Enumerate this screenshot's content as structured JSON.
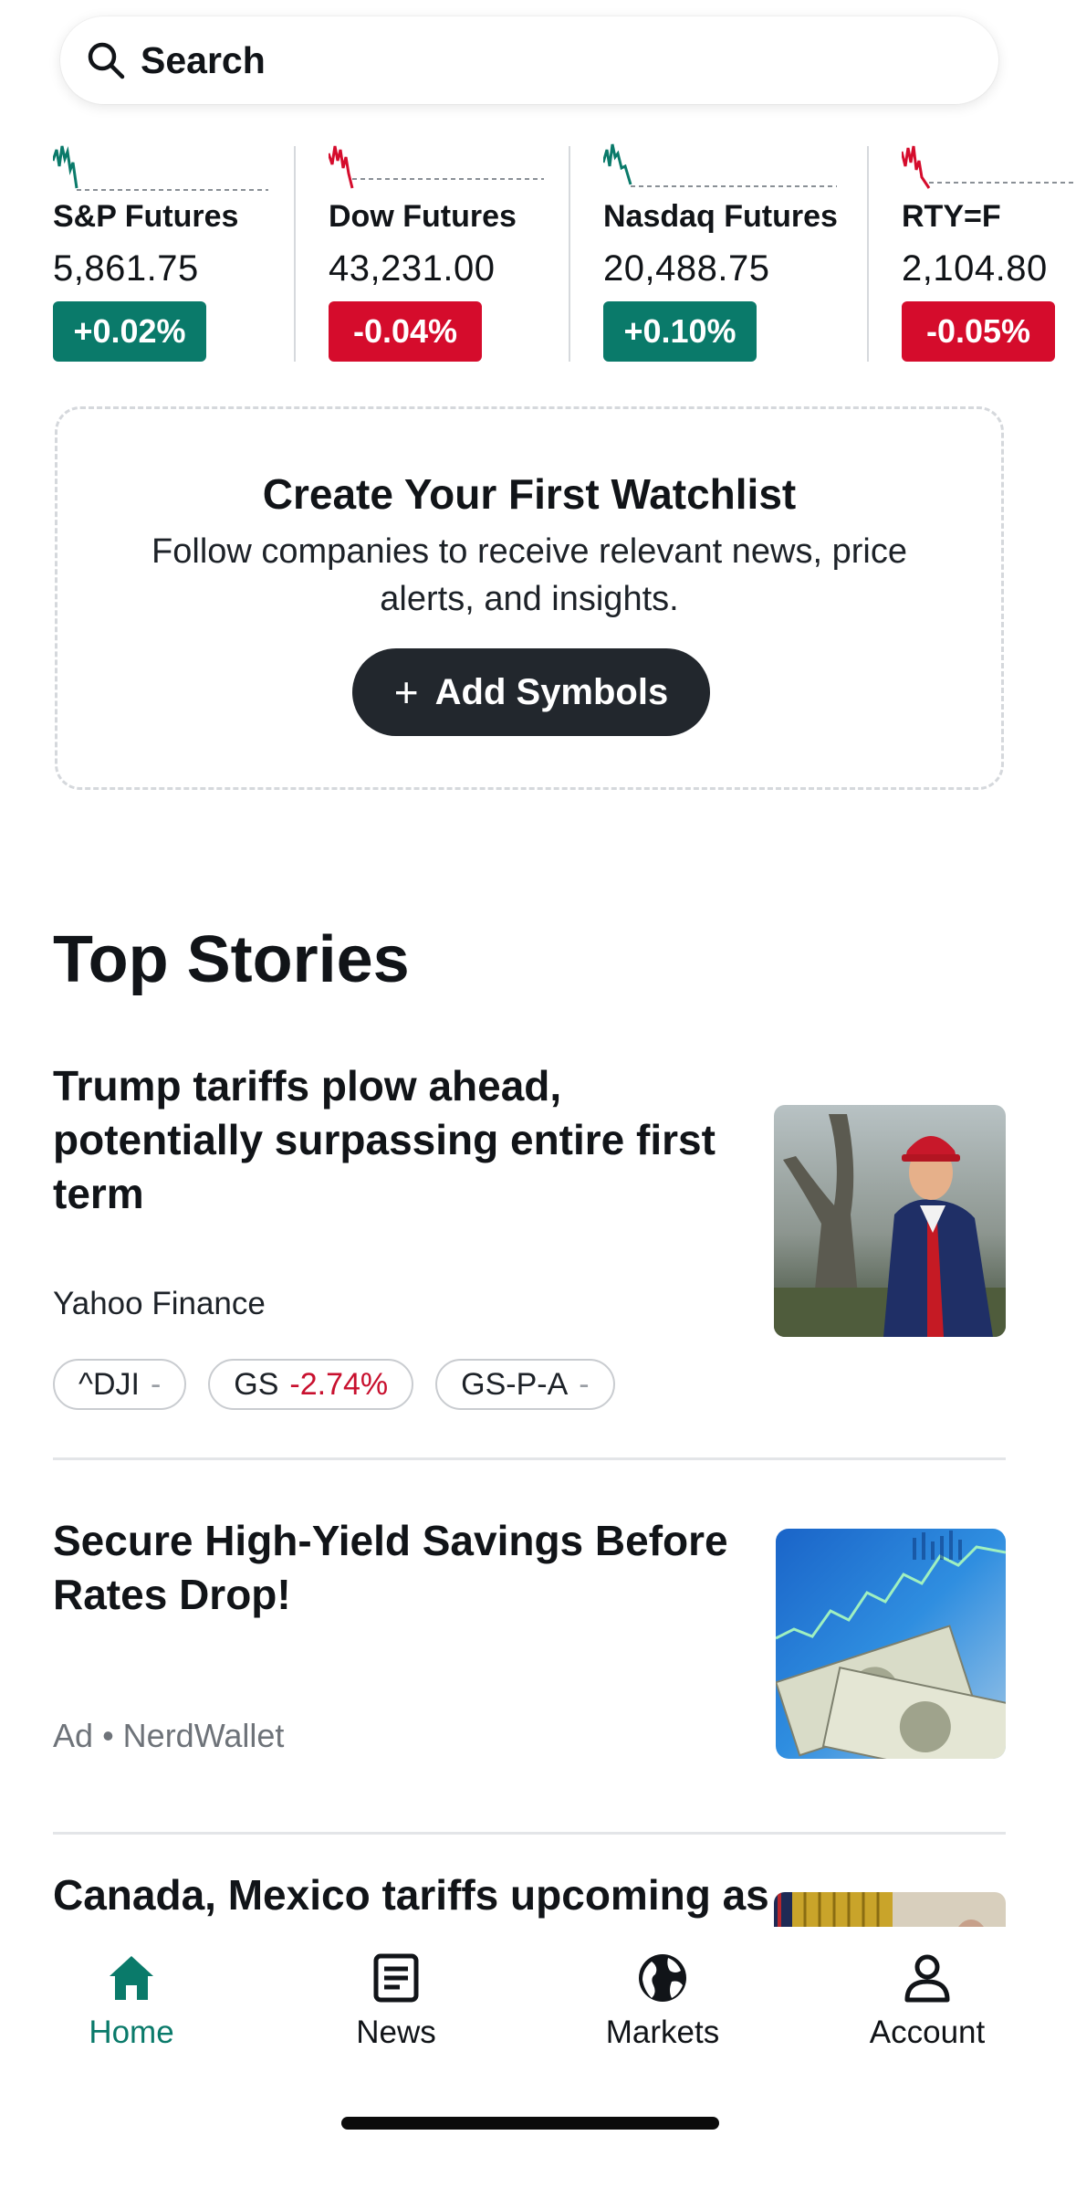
{
  "search": {
    "label": "Search",
    "icon": "search-icon"
  },
  "tickers": [
    {
      "name": "S&P Futures",
      "price": "5,861.75",
      "change": "+0.02%",
      "direction": "up",
      "color": "#0a7a6a"
    },
    {
      "name": "Dow Futures",
      "price": "43,231.00",
      "change": "-0.04%",
      "direction": "down",
      "color": "#d50c2c"
    },
    {
      "name": "Nasdaq Futures",
      "price": "20,488.75",
      "change": "+0.10%",
      "direction": "up",
      "color": "#0a7a6a"
    },
    {
      "name": "RTY=F",
      "price": "2,104.80",
      "change": "-0.05%",
      "direction": "down",
      "color": "#d50c2c"
    }
  ],
  "watchlist": {
    "title": "Create Your First Watchlist",
    "description": "Follow companies to receive relevant news, price alerts, and insights.",
    "button_label": "Add Symbols"
  },
  "top_stories": {
    "title": "Top Stories",
    "stories": [
      {
        "headline": "Trump tariffs plow ahead, potentially surpassing entire first term",
        "source": "Yahoo Finance",
        "chips": [
          {
            "symbol": "^DJI",
            "change": "-"
          },
          {
            "symbol": "GS",
            "change": "-2.74%"
          },
          {
            "symbol": "GS-P-A",
            "change": "-"
          }
        ]
      },
      {
        "headline": "Secure High-Yield Savings Before Rates Drop!",
        "ad_label": "Ad",
        "advertiser": "NerdWallet"
      },
      {
        "headline": "Canada, Mexico tariffs upcoming as Trump says 'no room left' for"
      }
    ]
  },
  "nav": {
    "items": [
      {
        "label": "Home",
        "icon": "home-icon",
        "active": true
      },
      {
        "label": "News",
        "icon": "news-icon",
        "active": false
      },
      {
        "label": "Markets",
        "icon": "globe-icon",
        "active": false
      },
      {
        "label": "Account",
        "icon": "account-icon",
        "active": false
      }
    ],
    "active_color": "#0a7a6a"
  }
}
